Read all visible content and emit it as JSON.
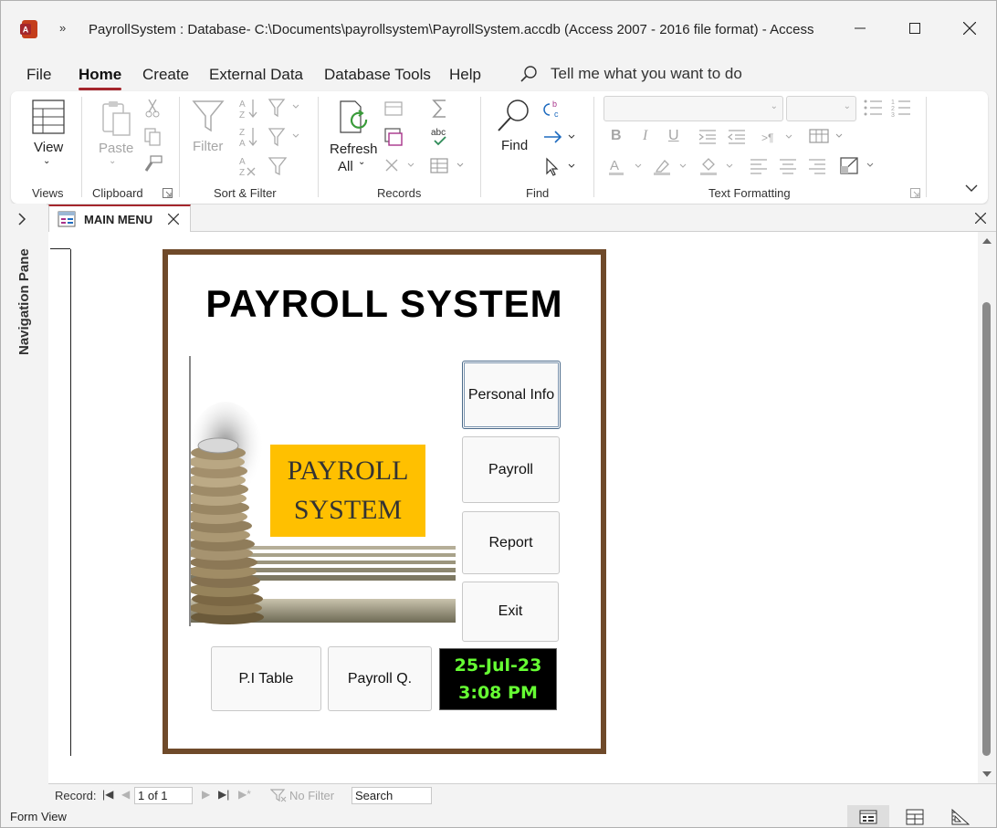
{
  "window": {
    "title": "PayrollSystem : Database- C:\\Documents\\payrollsystem\\PayrollSystem.accdb (Access 2007 - 2016 file format)  -  Access",
    "qat_more": "»"
  },
  "menu": {
    "tabs": [
      "File",
      "Home",
      "Create",
      "External Data",
      "Database Tools",
      "Help"
    ],
    "active": "Home",
    "tell_me": "Tell me what you want to do"
  },
  "ribbon": {
    "groups": {
      "views": "Views",
      "clipboard": "Clipboard",
      "sort_filter": "Sort & Filter",
      "records": "Records",
      "find": "Find",
      "text_formatting": "Text Formatting"
    },
    "buttons": {
      "view": "View",
      "paste": "Paste",
      "filter": "Filter",
      "refresh": "Refresh",
      "refresh_all": "All",
      "find": "Find"
    },
    "spelling_text": "abc"
  },
  "nav_pane": {
    "label": "Navigation Pane"
  },
  "doc_tab": {
    "label": "MAIN MENU"
  },
  "form": {
    "title": "PAYROLL SYSTEM",
    "image_caption": [
      "PAYROLL",
      "SYSTEM"
    ],
    "buttons": {
      "personal_info": "Personal Info",
      "payroll": "Payroll",
      "report": "Report",
      "exit": "Exit",
      "pi_table": "P.I Table",
      "payroll_q": "Payroll Q."
    },
    "clock": {
      "date": "25-Jul-23",
      "time": "3:08 PM"
    },
    "colors": {
      "frame": "#6f4a2a",
      "caption_bg": "#ffc000",
      "clock_text": "#66ff33"
    }
  },
  "record_nav": {
    "label": "Record:",
    "position": "1 of 1",
    "no_filter": "No Filter",
    "search": "Search"
  },
  "status": {
    "text": "Form View"
  }
}
